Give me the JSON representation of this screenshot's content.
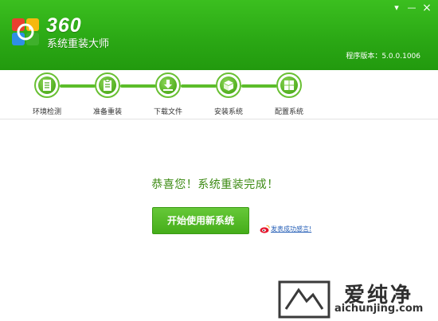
{
  "app": {
    "logo_number": "360",
    "logo_name": "系统重装大师",
    "version_label": "程序版本：5.0.0.1006",
    "window_controls": {
      "menu": "▾",
      "minimize": "—",
      "close": "×"
    }
  },
  "steps": [
    {
      "label": "环境检测",
      "icon": "document-icon"
    },
    {
      "label": "准备重装",
      "icon": "clipboard-icon"
    },
    {
      "label": "下载文件",
      "icon": "download-icon"
    },
    {
      "label": "安装系统",
      "icon": "box-icon"
    },
    {
      "label": "配置系统",
      "icon": "windows-icon"
    }
  ],
  "main": {
    "title": "恭喜您！系统重装完成！",
    "start_button": "开始使用新系统",
    "feedback_link": "发表成功感言!"
  },
  "watermark": {
    "text": "爱纯净",
    "url": "aichunjing.com"
  },
  "colors": {
    "header_green": "#2aa714",
    "accent_green": "#5cbd2a",
    "title_green": "#3c8a13",
    "link_blue": "#2a62b8"
  }
}
